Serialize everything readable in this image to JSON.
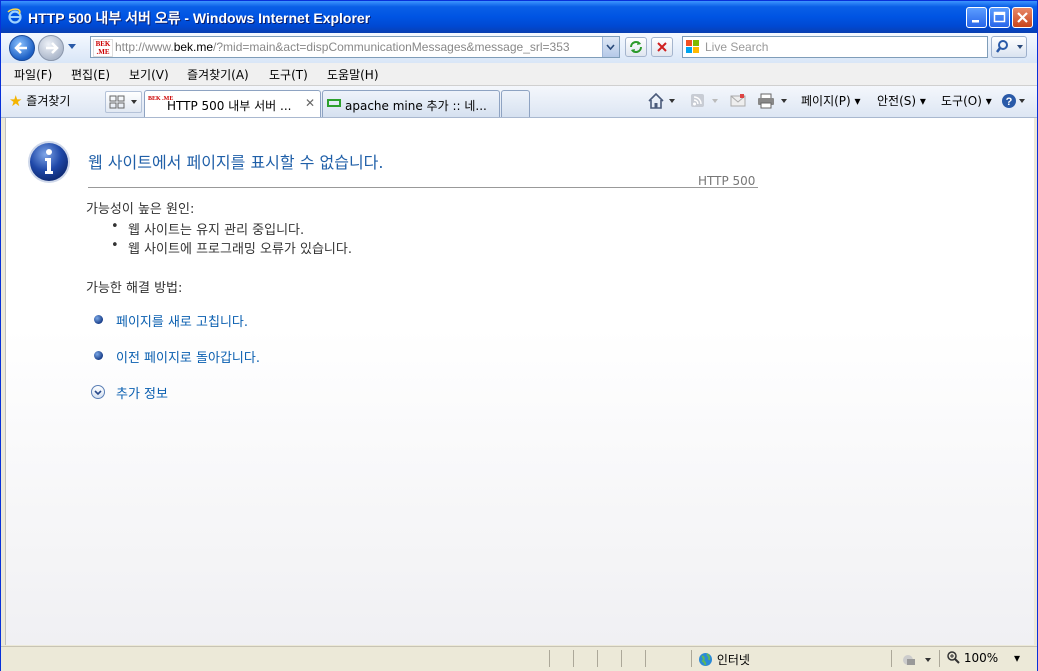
{
  "window": {
    "title": "HTTP 500 내부 서버 오류 - Windows Internet Explorer"
  },
  "address": {
    "favicon_text": "BEK .ME",
    "url_prefix": "http://www.",
    "url_domain": "bek.me",
    "url_rest": "/?mid=main&act=dispCommunicationMessages&message_srl=353"
  },
  "search": {
    "placeholder": "Live Search"
  },
  "menu": {
    "items": [
      "파일(F)",
      "편집(E)",
      "보기(V)",
      "즐겨찾기(A)",
      "도구(T)",
      "도움말(H)"
    ]
  },
  "toolbar": {
    "favorites_label": "즐겨찾기",
    "tabs": [
      {
        "label": "HTTP 500 내부 서버 ...",
        "favicon_text": "BEK .ME"
      },
      {
        "label": "apache mine 추가 :: 네..."
      }
    ],
    "commands": {
      "page": "페이지(P)",
      "safety": "안전(S)",
      "tools": "도구(O)"
    }
  },
  "content": {
    "heading": "웹 사이트에서 페이지를 표시할 수 없습니다.",
    "http_code": "HTTP 500",
    "causes_title": "가능성이 높은 원인:",
    "causes": [
      "웹 사이트는 유지 관리 중입니다.",
      "웹 사이트에 프로그래밍 오류가 있습니다."
    ],
    "fixes_title": "가능한 해결 방법:",
    "fixes": [
      "페이지를 새로 고칩니다.",
      "이전 페이지로 돌아갑니다."
    ],
    "more_info": "추가 정보"
  },
  "status": {
    "zone": "인터넷",
    "zoom": "100%"
  },
  "colors": {
    "titlebar": "#0054e3",
    "heading": "#1f5fa8",
    "link": "#0a5fb0"
  }
}
